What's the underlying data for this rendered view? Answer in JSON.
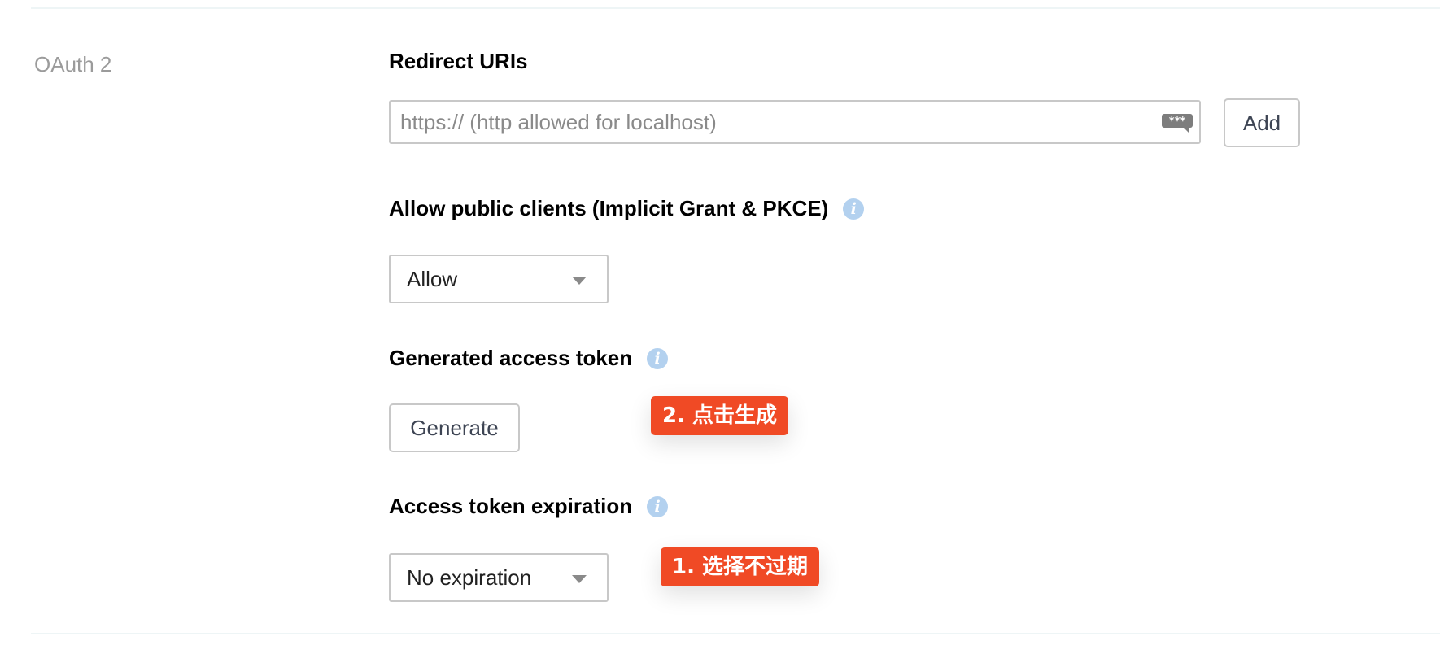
{
  "section": {
    "label": "OAuth 2"
  },
  "redirect_uris": {
    "title": "Redirect URIs",
    "input_value": "",
    "placeholder": "https:// (http allowed for localhost)",
    "add_label": "Add"
  },
  "public_clients": {
    "title": "Allow public clients (Implicit Grant & PKCE)",
    "selected": "Allow"
  },
  "access_token": {
    "title": "Generated access token",
    "generate_label": "Generate"
  },
  "expiration": {
    "title": "Access token expiration",
    "selected": "No expiration"
  },
  "annotations": {
    "generate": "2. 点击生成",
    "expiration": "1. 选择不过期"
  },
  "icons": {
    "info": "info-icon",
    "password_manager": "password-manager-icon",
    "caret": "chevron-down-icon"
  },
  "colors": {
    "annotation": "#f04a25",
    "info_icon": "#b3d1ef",
    "section_label": "#9b9b9b"
  }
}
